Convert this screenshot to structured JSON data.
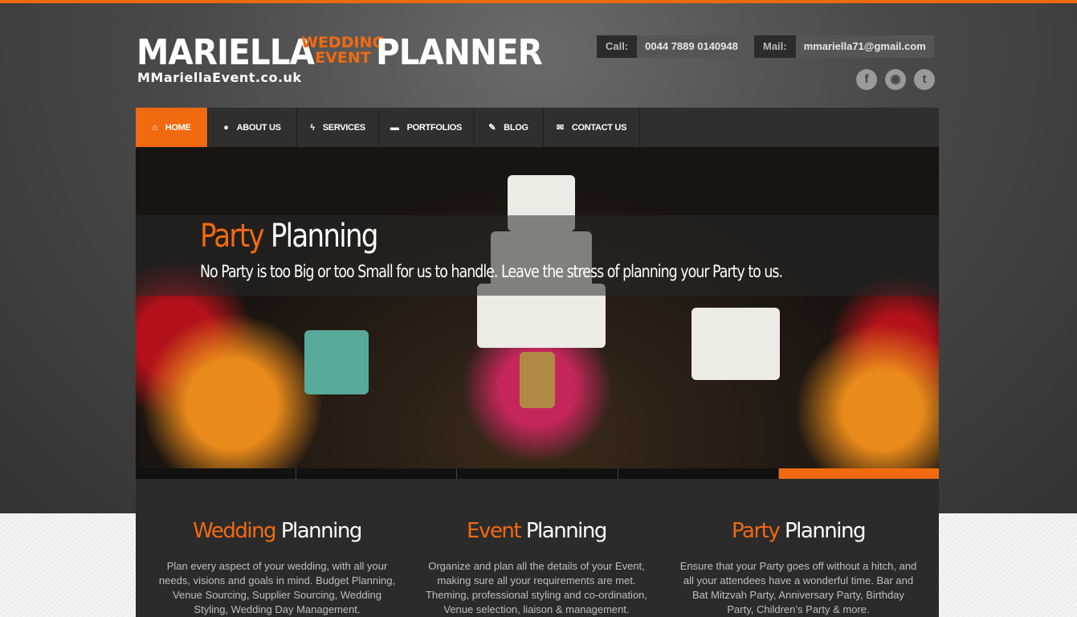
{
  "brand": {
    "name_left": "MARIELLA",
    "name_mid_top": "WEDDING",
    "name_mid_bottom": "EVENT",
    "name_right": "PLANNER",
    "url": "MMariellaEvent.co.uk"
  },
  "contact": {
    "call_label": "Call:",
    "call_value": "0044 7889 0140948",
    "mail_label": "Mail:",
    "mail_value": "mmariella71@gmail.com"
  },
  "social": [
    {
      "icon": "facebook-icon",
      "glyph": "f"
    },
    {
      "icon": "rss-icon",
      "glyph": "◉"
    },
    {
      "icon": "twitter-icon",
      "glyph": "t"
    }
  ],
  "nav": [
    {
      "label": "HOME",
      "icon": "home-icon",
      "glyph": "⌂",
      "active": true
    },
    {
      "label": "ABOUT US",
      "icon": "user-icon",
      "glyph": "●"
    },
    {
      "label": "SERVICES",
      "icon": "bolt-icon",
      "glyph": "ϟ"
    },
    {
      "label": "PORTFOLIOS",
      "icon": "briefcase-icon",
      "glyph": "▬"
    },
    {
      "label": "BLOG",
      "icon": "pencil-icon",
      "glyph": "✎"
    },
    {
      "label": "CONTACT US",
      "icon": "envelope-icon",
      "glyph": "✉"
    }
  ],
  "slider": {
    "title_accent": "Party",
    "title_rest": "Planning",
    "subtitle": "No Party is too Big or too Small for us to handle. Leave the stress of planning your Party to us.",
    "active_slide": 5,
    "slide_count": 5
  },
  "features": [
    {
      "accent": "Wedding",
      "rest": "Planning",
      "text": "Plan every aspect of your wedding, with all your needs, visions and goals in mind. Budget Planning, Venue Sourcing, Supplier Sourcing, Wedding Styling, Wedding Day Management."
    },
    {
      "accent": "Event",
      "rest": "Planning",
      "text": "Organize and plan all the details of your Event, making sure all your requirements are met. Theming, professional styling and co-ordination, Venue selection, liaison & management."
    },
    {
      "accent": "Party",
      "rest": "Planning",
      "text": "Ensure that your Party goes off without a hitch, and all your attendees have a wonderful time. Bar and Bat Mitzvah Party, Anniversary Party, Birthday Party, Children’s Party & more."
    }
  ],
  "colors": {
    "accent": "#f26a10",
    "nav_bg": "#2f2f2f",
    "content_bg": "#2b2b2b"
  }
}
